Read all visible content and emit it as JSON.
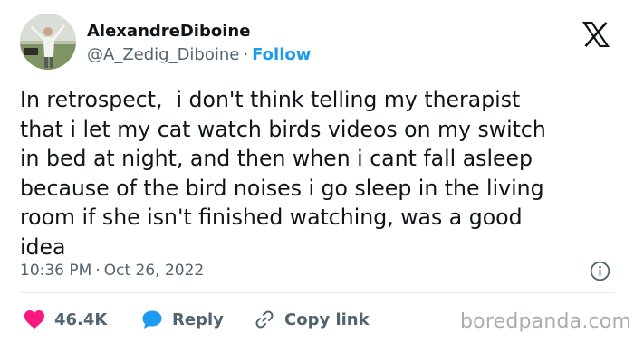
{
  "author": {
    "display_name": "AlexandreDiboine",
    "handle": "@A_Zedig_Diboine",
    "separator": "·",
    "follow_label": "Follow"
  },
  "tweet": {
    "text": "In retrospect,  i don't think telling my therapist\nthat i let my cat watch birds videos on my switch\nin bed at night, and then when i cant fall asleep\nbecause of the bird noises i go sleep in the living\nroom if she isn't finished watching, was a good\nidea",
    "time": "10:36 PM",
    "separator": "·",
    "date": "Oct 26, 2022"
  },
  "actions": {
    "like_count": "46.4K",
    "reply_label": "Reply",
    "copy_link_label": "Copy link"
  },
  "watermark": "boredpanda.com",
  "icons": {
    "logo": "x-logo-icon",
    "info": "info-icon",
    "like": "heart-icon",
    "reply": "speech-bubble-icon",
    "copy": "link-icon"
  },
  "colors": {
    "text": "#0f1419",
    "secondary": "#536471",
    "accent": "#1d9bf0",
    "like": "#f91880",
    "divider": "#e4e9ec",
    "watermark": "#a9adb1"
  }
}
